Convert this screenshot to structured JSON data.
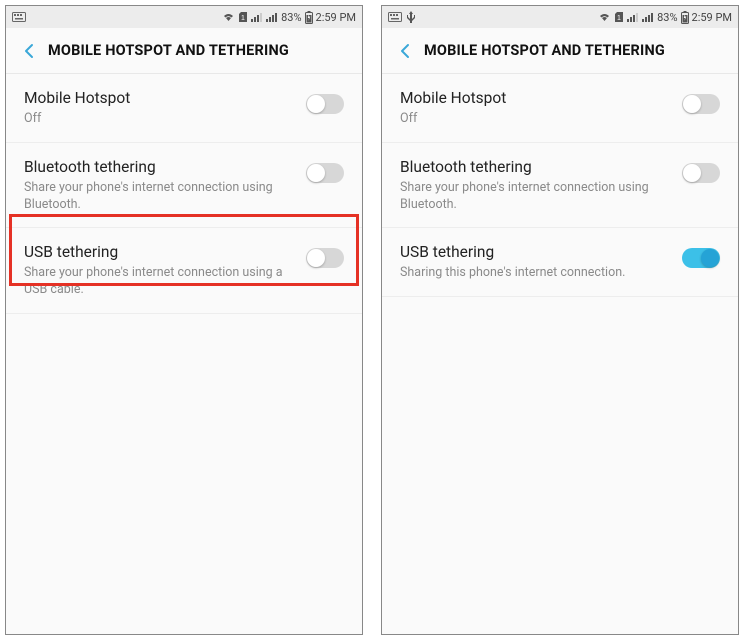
{
  "status": {
    "battery": "83%",
    "time": "2:59 PM"
  },
  "header": {
    "title": "MOBILE HOTSPOT AND TETHERING"
  },
  "screens": [
    {
      "highlight_usb": true,
      "rows": [
        {
          "title": "Mobile Hotspot",
          "sub": "Off",
          "on": false
        },
        {
          "title": "Bluetooth tethering",
          "sub": "Share your phone's internet connection using Bluetooth.",
          "on": false
        },
        {
          "title": "USB tethering",
          "sub": "Share your phone's internet connection using a USB cable.",
          "on": false
        }
      ]
    },
    {
      "highlight_usb": false,
      "rows": [
        {
          "title": "Mobile Hotspot",
          "sub": "Off",
          "on": false
        },
        {
          "title": "Bluetooth tethering",
          "sub": "Share your phone's internet connection using Bluetooth.",
          "on": false
        },
        {
          "title": "USB tethering",
          "sub": "Sharing this phone's internet connection.",
          "on": true
        }
      ]
    }
  ]
}
